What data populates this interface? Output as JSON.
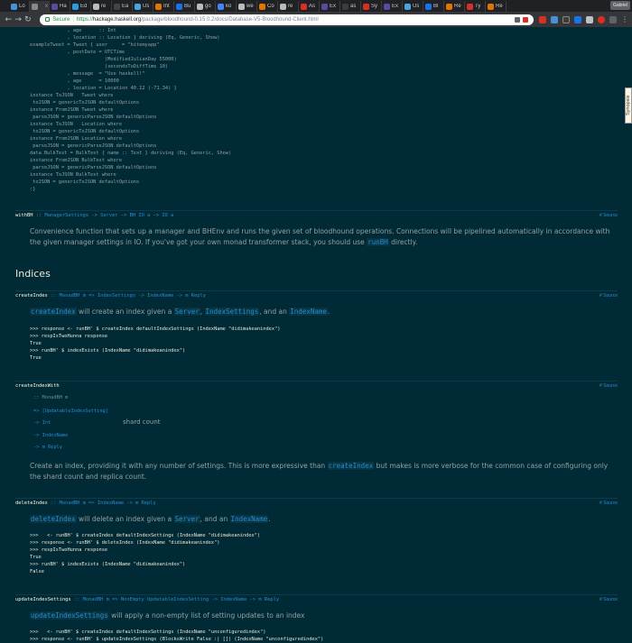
{
  "browser": {
    "tabs": [
      {
        "label": "Lo",
        "color": "#4a90d9"
      },
      {
        "label": "",
        "color": "#888888",
        "close": "x"
      },
      {
        "label": "Ha",
        "color": "#5c4a9e"
      },
      {
        "label": "Ed",
        "color": "#2d9cdb"
      },
      {
        "label": "re",
        "color": "#bbbbbb"
      },
      {
        "label": "Ea",
        "color": "#444444"
      },
      {
        "label": "Us",
        "color": "#4aa3df"
      },
      {
        "label": "Int",
        "color": "#e37400"
      },
      {
        "label": "Bu",
        "color": "#1a73e8"
      },
      {
        "label": "go",
        "color": "#bbbbbb"
      },
      {
        "label": "ko",
        "color": "#4285f4"
      },
      {
        "label": "we",
        "color": "#bbbbbb"
      },
      {
        "label": "Co",
        "color": "#e37400"
      },
      {
        "label": "re",
        "color": "#bbbbbb"
      },
      {
        "label": "As",
        "color": "#d93025"
      },
      {
        "label": "Ex",
        "color": "#5c4a9e"
      },
      {
        "label": "as",
        "color": "#3c3c3c"
      },
      {
        "label": "Sy",
        "color": "#d93025"
      },
      {
        "label": "Ex",
        "color": "#5c4a9e"
      },
      {
        "label": "Us",
        "color": "#4aa3df"
      },
      {
        "label": "Bl",
        "color": "#1a73e8"
      },
      {
        "label": "Re",
        "color": "#e37400"
      },
      {
        "label": "Ty",
        "color": "#d93025"
      },
      {
        "label": "Re",
        "color": "#e37400"
      }
    ],
    "profile": "Gabriel",
    "secure_label": "Secure",
    "url_scheme": "https://",
    "url_host": "hackage.haskell.org",
    "url_path": "/package/bloodhound-0.15.0.2/docs/Database-V5-Bloodhound-Client.html"
  },
  "code_example": [
    "             , age      :: Int",
    "             , location :: Location } deriving (Eq, Generic, Show)",
    "exampleTweet = Tweet { user     = \"bitemyapp\"",
    "             , postDate = UTCTime",
    "                          (ModifiedJulianDay 55000)",
    "                          (secondsToDiffTime 10)",
    "             , message  = \"Use haskell!\"",
    "             , age      = 10000",
    "             , location = Location 40.12 (-71.34) }",
    "instance ToJSON   Tweet where",
    " toJSON = genericToJSON defaultOptions",
    "instance FromJSON Tweet where",
    " parseJSON = genericParseJSON defaultOptions",
    "instance ToJSON   Location where",
    " toJSON = genericToJSON defaultOptions",
    "instance FromJSON Location where",
    " parseJSON = genericParseJSON defaultOptions",
    "data BulkTest = BulkTest { name :: Text } deriving (Eq, Generic, Show)",
    "instance FromJSON BulkTest where",
    " parseJSON = genericParseJSON defaultOptions",
    "instance ToJSON BulkTest where",
    " toJSON = genericToJSON defaultOptions",
    ":}"
  ],
  "synopsis_label": "Synopsis",
  "withBH": {
    "name": "withBH",
    "sig_a": " :: ",
    "t1": "ManagerSettings",
    "arrow1": " -> ",
    "t2": "Server",
    "arrow2": " -> ",
    "t3": "BH IO a",
    "arrow3": " -> ",
    "t4": "IO a",
    "source": "Source",
    "desc_1": "Convenience function that sets up a manager and BHEnv and runs the given set of bloodhound operations. Connections will be pipelined automatically in accordance with the given manager settings in IO. If you've got your own monad transformer stack, you should use ",
    "desc_ref": "runBH",
    "desc_2": " directly."
  },
  "indices_heading": "Indices",
  "createIndex": {
    "name": "createIndex",
    "sig": " :: MonadBH m => IndexSettings -> IndexName -> m Reply",
    "source": "Source",
    "ref1": "createIndex",
    "t1": " will create an index given a ",
    "ref2": "Server",
    "t2": ", ",
    "ref3": "IndexSettings",
    "t3": ", and an ",
    "ref4": "IndexName",
    "t4": ".",
    "code": ">>> response <- runBH' $ createIndex defaultIndexSettings (IndexName \"didimakeanindex\")\n>>> respIsTwoHunna response\nTrue\n>>> runBH' $ indexExists (IndexName \"didimakeanindex\")\nTrue"
  },
  "createIndexWith": {
    "name": "createIndexWith",
    "source": "Source",
    "arg1": ":: MonadBH m",
    "arg2": "=> [UpdatableIndexSetting]",
    "arg3": "-> Int",
    "arg3_doc": "shard count",
    "arg4": "-> IndexName",
    "arg5": "-> m Reply",
    "desc_1": "Create an index, providing it with any number of settings. This is more expressive than ",
    "desc_ref": "createIndex",
    "desc_2": " but makes is more verbose for the common case of configuring only the shard count and replica count."
  },
  "deleteIndex": {
    "name": "deleteIndex",
    "sig": " :: MonadBH m => IndexName -> m Reply",
    "source": "Source",
    "ref1": "deleteIndex",
    "t1": " will delete an index given a ",
    "ref2": "Server",
    "t2": ", and an ",
    "ref3": "IndexName",
    "t3": ".",
    "code": ">>>   <- runBH' $ createIndex defaultIndexSettings (IndexName \"didimakeanindex\")\n>>> response <- runBH' $ deleteIndex (IndexName \"didimakeanindex\")\n>>> respIsTwoHunna response\nTrue\n>>> runBH' $ indexExists (IndexName \"didimakeanindex\")\nFalse"
  },
  "updateIndexSettings": {
    "name": "updateIndexSettings",
    "sig": " :: MonadBH m => NonEmpty UpdatableIndexSetting -> IndexName -> m Reply",
    "source": "Source",
    "ref1": "updateIndexSettings",
    "t1": " will apply a non-empty list of setting updates to an index",
    "code": ">>>   <- runBH' $ createIndex defaultIndexSettings (IndexName \"unconfiguredindex\")\n>>> response <- runBH' $ updateIndexSettings (BlocksWrite False :| []) (IndexName \"unconfiguredindex\")"
  }
}
